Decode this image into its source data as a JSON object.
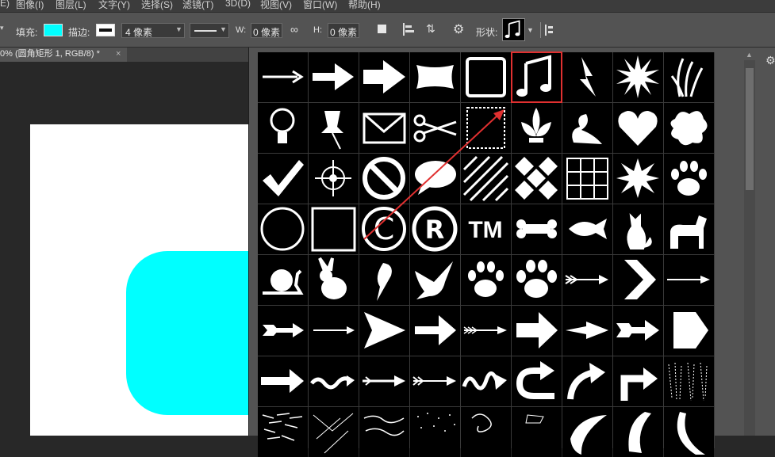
{
  "menu": [
    "E)",
    "图像(I)",
    "图层(L)",
    "文字(Y)",
    "选择(S)",
    "滤镜(T)",
    "3D(D)",
    "视图(V)",
    "窗口(W)",
    "帮助(H)"
  ],
  "options": {
    "fill_label": "填充:",
    "stroke_label": "描边:",
    "stroke_width": "4 像素",
    "w_label": "W:",
    "w_value": "0 像素",
    "h_label": "H:",
    "h_value": "0 像素",
    "shape_label": "形状:",
    "fill_color": "#00ffff"
  },
  "document": {
    "tab_title": "0% (圆角矩形 1, RGB/8) *",
    "close": "×"
  },
  "canvas": {
    "shape_color": "#00ffff",
    "background": "#ffffff"
  },
  "shape_picker": {
    "highlight_color": "#e03030",
    "selected_shape": "music-note",
    "shapes": [
      "arrow-thin",
      "arrow-block",
      "arrow-fat",
      "banner",
      "frame-ornate",
      "music-note",
      "lightning",
      "starburst",
      "grass",
      "lightbulb",
      "pushpin",
      "envelope",
      "scissors",
      "stamp",
      "fleur-de-lis",
      "ornament",
      "heart",
      "splat",
      "checkmark",
      "crosshair",
      "no-symbol",
      "speech-bubble",
      "hatched-square",
      "diamond-checker",
      "grid",
      "burst",
      "paw-print",
      "circle-frame",
      "square-frame",
      "copyright",
      "registered",
      "trademark",
      "bone",
      "fish",
      "cat",
      "dog",
      "snail",
      "rabbit",
      "bird",
      "dove",
      "paw-print-2",
      "paw-print-3",
      "arrow-feathered",
      "chevron",
      "arrow-thin-2",
      "arrow-tailed",
      "arrow-thin-3",
      "arrowhead",
      "arrow-bold",
      "arrow-fletched",
      "arrow-block-2",
      "arrow-narrow",
      "arrow-tailed-2",
      "arrow-pentagon",
      "arrow-simple",
      "wave",
      "arrow-dotted",
      "arrow-fletched-2",
      "squiggle",
      "u-turn-arrow",
      "curved-arrow",
      "turn-arrow",
      "texture-hair",
      "texture-1",
      "texture-2",
      "texture-3",
      "texture-4",
      "texture-5",
      "texture-6",
      "leaf",
      "leaf-2",
      "crescent"
    ],
    "symbols": {
      "trademark": "TM",
      "registered": "R",
      "copyright": "C"
    }
  }
}
